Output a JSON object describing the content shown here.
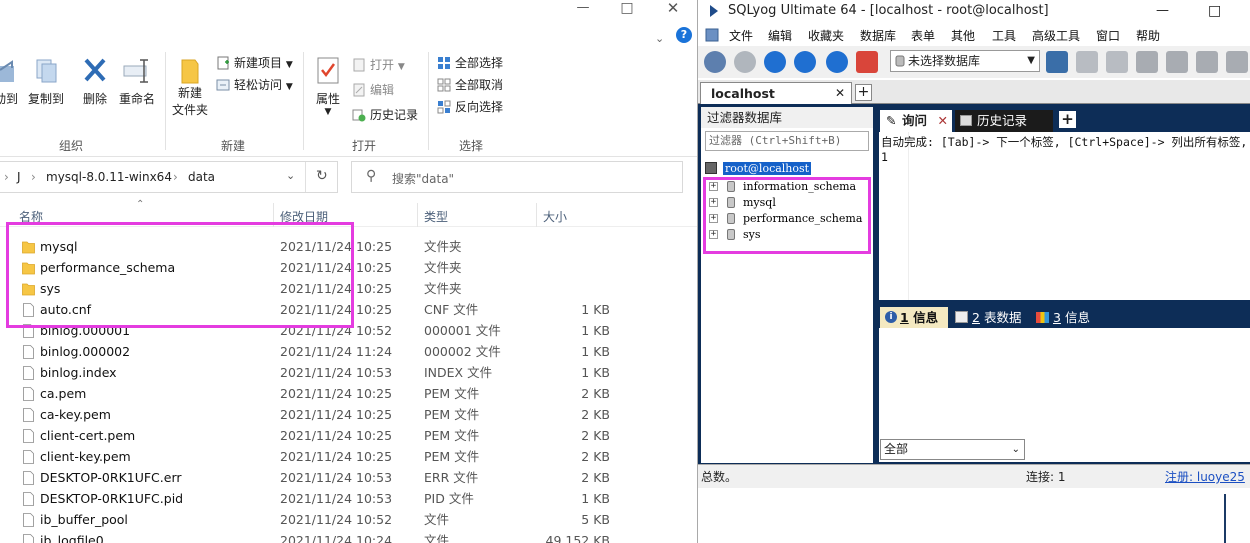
{
  "explorer": {
    "ribbon": {
      "cut_label": "动到",
      "copy_to_label": "复制到",
      "delete_label": "删除",
      "rename_label": "重命名",
      "new_folder_label_1": "新建",
      "new_folder_label_2": "文件夹",
      "new_item_label": "新建项目",
      "easy_access_label": "轻松访问",
      "properties_label": "属性",
      "open_label": "打开",
      "edit_label": "编辑",
      "history_label": "历史记录",
      "select_all_label": "全部选择",
      "select_none_label": "全部取消",
      "invert_selection_label": "反向选择",
      "group_organize": "组织",
      "group_new": "新建",
      "group_open": "打开",
      "group_select": "选择"
    },
    "address": {
      "crumbs": [
        "J",
        "mysql-8.0.11-winx64",
        "data"
      ]
    },
    "search": {
      "placeholder": "搜索\"data\""
    },
    "columns": {
      "name": "名称",
      "date": "修改日期",
      "type": "类型",
      "size": "大小"
    },
    "files": [
      {
        "name": "mysql",
        "date": "2021/11/24 10:25",
        "type": "文件夹",
        "size": "",
        "kind": "folder"
      },
      {
        "name": "performance_schema",
        "date": "2021/11/24 10:25",
        "type": "文件夹",
        "size": "",
        "kind": "folder"
      },
      {
        "name": "sys",
        "date": "2021/11/24 10:25",
        "type": "文件夹",
        "size": "",
        "kind": "folder"
      },
      {
        "name": "auto.cnf",
        "date": "2021/11/24 10:25",
        "type": "CNF 文件",
        "size": "1 KB",
        "kind": "file"
      },
      {
        "name": "binlog.000001",
        "date": "2021/11/24 10:52",
        "type": "000001 文件",
        "size": "1 KB",
        "kind": "file"
      },
      {
        "name": "binlog.000002",
        "date": "2021/11/24 11:24",
        "type": "000002 文件",
        "size": "1 KB",
        "kind": "file"
      },
      {
        "name": "binlog.index",
        "date": "2021/11/24 10:53",
        "type": "INDEX 文件",
        "size": "1 KB",
        "kind": "file"
      },
      {
        "name": "ca.pem",
        "date": "2021/11/24 10:25",
        "type": "PEM 文件",
        "size": "2 KB",
        "kind": "file"
      },
      {
        "name": "ca-key.pem",
        "date": "2021/11/24 10:25",
        "type": "PEM 文件",
        "size": "2 KB",
        "kind": "file"
      },
      {
        "name": "client-cert.pem",
        "date": "2021/11/24 10:25",
        "type": "PEM 文件",
        "size": "2 KB",
        "kind": "file"
      },
      {
        "name": "client-key.pem",
        "date": "2021/11/24 10:25",
        "type": "PEM 文件",
        "size": "2 KB",
        "kind": "file"
      },
      {
        "name": "DESKTOP-0RK1UFC.err",
        "date": "2021/11/24 10:53",
        "type": "ERR 文件",
        "size": "2 KB",
        "kind": "file"
      },
      {
        "name": "DESKTOP-0RK1UFC.pid",
        "date": "2021/11/24 10:53",
        "type": "PID 文件",
        "size": "1 KB",
        "kind": "file"
      },
      {
        "name": "ib_buffer_pool",
        "date": "2021/11/24 10:52",
        "type": "文件",
        "size": "5 KB",
        "kind": "file"
      },
      {
        "name": "ib_logfile0",
        "date": "2021/11/24 10:24",
        "type": "文件",
        "size": "49,152 KB",
        "kind": "file"
      }
    ]
  },
  "sqlyog": {
    "title": "SQLyog Ultimate 64 - [localhost - root@localhost]",
    "menu": [
      "文件",
      "编辑",
      "收藏夹",
      "数据库",
      "表单",
      "其他",
      "工具",
      "高级工具",
      "窗口",
      "帮助"
    ],
    "db_select": "未选择数据库",
    "connection_tab": "localhost",
    "object_browser": {
      "header": "过滤器数据库",
      "filter_placeholder": "过滤器 (Ctrl+Shift+B)",
      "root": "root@localhost",
      "databases": [
        "information_schema",
        "mysql",
        "performance_schema",
        "sys"
      ]
    },
    "query": {
      "tab_query": "询问",
      "tab_history": "历史记录",
      "hint": "自动完成: [Tab]-> 下一个标签, [Ctrl+Space]-> 列出所有标签,",
      "line_no": "1"
    },
    "results": {
      "tab1_num": "1",
      "tab1_label": "信息",
      "tab2_num": "2",
      "tab2_label": "表数据",
      "tab3_num": "3",
      "tab3_label": "信息",
      "filter_all": "全部"
    },
    "status": {
      "total": "总数。",
      "connections": "连接: 1",
      "register": "注册: luoye25"
    }
  }
}
